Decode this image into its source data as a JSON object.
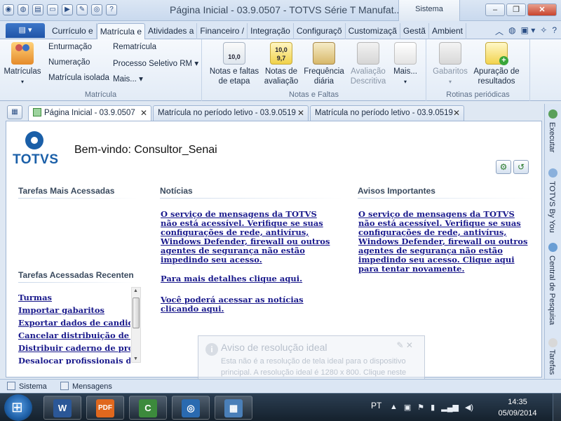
{
  "titlebar": {
    "title": "Página Inicial - 03.9.0507 - TOTVS Série T Manufat...",
    "context_tab": "Sistema"
  },
  "menu": {
    "tabs": [
      "Currículo e",
      "Matrícula e",
      "Atividades a",
      "Financeiro /",
      "Integração",
      "Configuraçõ",
      "Customizaçã",
      "Gestã",
      "Ambient"
    ],
    "active_tab": "Matrícula e"
  },
  "ribbon": {
    "matricula": {
      "big_button": "Matrículas",
      "items_col1": [
        "Enturmação",
        "Numeração",
        "Matrícula isolada"
      ],
      "items_col2": [
        "Rematrícula",
        "Processo Seletivo RM",
        "Mais..."
      ],
      "label": "Matrícula"
    },
    "notas": {
      "buttons": [
        {
          "label": "Notas e faltas\nde etapa",
          "enabled": true
        },
        {
          "label": "Notas de\navaliação",
          "enabled": true
        },
        {
          "label": "Frequência\ndiária",
          "enabled": true
        },
        {
          "label": "Avaliação\nDescritiva",
          "enabled": false
        },
        {
          "label": "Mais...",
          "enabled": true
        }
      ],
      "label": "Notas e Faltas",
      "icon_text_notas": "10,0",
      "icon_text_aval": "10,0\n9,7"
    },
    "rotinas": {
      "buttons": [
        {
          "label": "Gabaritos",
          "enabled": false
        },
        {
          "label": "Apuração de\nresultados",
          "enabled": true
        }
      ],
      "label": "Rotinas periódicas"
    }
  },
  "doc_tabs": [
    {
      "label": "Página Inicial - 03.9.0507",
      "active": true
    },
    {
      "label": "Matrícula no período letivo - 03.9.0519",
      "active": false
    },
    {
      "label": "Matrícula no período letivo - 03.9.0519",
      "active": false
    }
  ],
  "home": {
    "logo_text": "TOTVS",
    "welcome": "Bem-vindo: Consultor_Senai",
    "tarefas_mais": "Tarefas Mais Acessadas",
    "tarefas_recentes": "Tarefas Acessadas Recenten",
    "recent_items": [
      "Turmas",
      "Importar gabaritos",
      "Exportar dados de candidato",
      "Cancelar distribuição de cad",
      "Distribuir caderno de prova",
      "Desalocar profissionais dos l"
    ],
    "noticias_title": "Notícias",
    "noticias_msg": "O serviço de mensagens da TOTVS não está acessível. Verifique se suas configurações de rede, antivírus, Windows Defender, firewall ou outros agentes de segurança não estão impedindo seu acesso.",
    "noticias_link1": "Para mais detalhes clique aqui.",
    "noticias_link2": "Você poderá acessar as notícias clicando aqui.",
    "avisos_title": "Avisos Importantes",
    "avisos_msg": "O serviço de mensagens da TOTVS não está acessível. Verifique se suas configurações de rede, antivírus, Windows Defender, firewall ou outros agentes de segurança não estão impedindo seu acesso. Clique aqui para tentar novamente."
  },
  "toast": {
    "title": "Aviso de resolução ideal",
    "body": "Esta não é a resolução de tela ideal para o dispositivo principal. A resolução ideal é 1280 x 800. Clique neste aviso para obter mais informações."
  },
  "side_panel": [
    "Executar",
    "TOTVS By You",
    "Central de Pesquisa",
    "Tarefas"
  ],
  "statusbar": {
    "sistema": "Sistema",
    "mensagens": "Mensagens"
  },
  "taskbar": {
    "lang": "PT",
    "time": "14:35",
    "date": "05/09/2014"
  },
  "colors": {
    "accent": "#1f54a7",
    "link": "#1a1a8c",
    "brand": "#1a5fa8"
  }
}
